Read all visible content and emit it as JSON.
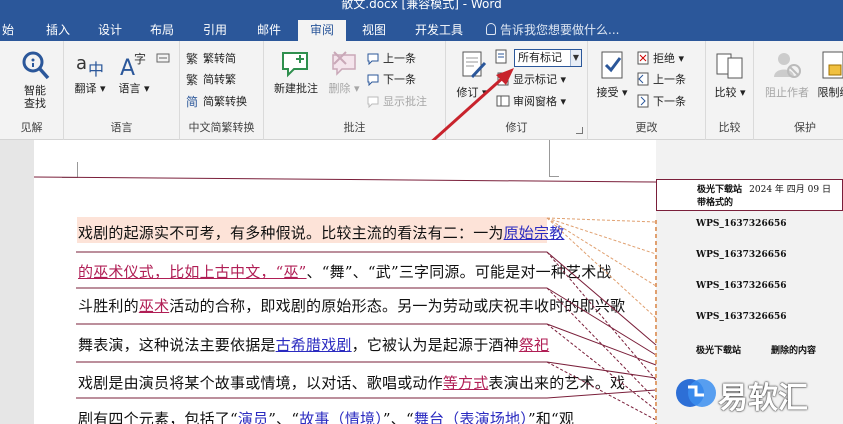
{
  "window": {
    "title": "散文.docx [兼容模式] - Word"
  },
  "tabs": [
    "始",
    "插入",
    "设计",
    "布局",
    "引用",
    "邮件",
    "审阅",
    "视图",
    "开发工具"
  ],
  "active_tab": "审阅",
  "tell_me": "告诉我您想要做什么...",
  "groups": {
    "proofing": {
      "label": "见解",
      "smart_lookup": "智能\n查找"
    },
    "language": {
      "label": "语言",
      "translate": "翻译",
      "language": "语言"
    },
    "chinese_conversion": {
      "label": "中文简繁转换",
      "to_traditional": "繁转简",
      "to_simplified": "简转繁",
      "convert": "简繁转换"
    },
    "comments": {
      "label": "批注",
      "new_comment": "新建批注",
      "delete": "删除",
      "previous": "上一条",
      "next": "下一条",
      "show_comments": "显示批注"
    },
    "tracking": {
      "label": "修订",
      "track_changes": "修订",
      "markup_dropdown": "所有标记",
      "show_markup": "显示标记",
      "reviewing_pane": "审阅窗格"
    },
    "changes": {
      "label": "更改",
      "accept": "接受",
      "reject": "拒绝",
      "previous": "上一条",
      "next": "下一条"
    },
    "compare": {
      "label": "比较",
      "compare": "比较"
    },
    "protect": {
      "label": "保护",
      "block_authors": "阻止作者",
      "restrict_editing": "限制编"
    }
  },
  "document": {
    "lines": [
      {
        "segments": [
          {
            "t": "戏剧的起源实不可考，有多种假说。比较主流的看法有二：一为",
            "s": ""
          },
          {
            "t": "原始宗教",
            "s": "ins"
          }
        ]
      },
      {
        "segments": [
          {
            "t": "的巫术仪式，比如上古中文，“巫”",
            "s": "ins2"
          },
          {
            "t": "、“舞”、“武”三字同源。可能是对一种艺术战",
            "s": ""
          }
        ]
      },
      {
        "segments": [
          {
            "t": "斗胜利的",
            "s": ""
          },
          {
            "t": "巫术",
            "s": "ins2"
          },
          {
            "t": "活动的合称，即戏剧的原始形态。另一为劳动或庆祝丰收时的即兴歌",
            "s": ""
          }
        ]
      },
      {
        "segments": [
          {
            "t": "舞表演，这种说法主要依据是",
            "s": ""
          },
          {
            "t": "古希腊戏剧",
            "s": "ins"
          },
          {
            "t": "，它被认为是起源于酒神",
            "s": ""
          },
          {
            "t": "祭祀",
            "s": "ins2"
          }
        ]
      },
      {
        "segments": [
          {
            "t": "戏剧是由演员将某个故事或情境，以对话、歌唱或动作",
            "s": ""
          },
          {
            "t": "等方式",
            "s": "ins2"
          },
          {
            "t": "表演出来的艺术。戏",
            "s": ""
          }
        ]
      },
      {
        "segments": [
          {
            "t": "剧有四个元素，包括了“",
            "s": ""
          },
          {
            "t": "演员",
            "s": "ins"
          },
          {
            "t": "”、“",
            "s": ""
          },
          {
            "t": "故事（情境）",
            "s": "ins"
          },
          {
            "t": "”、“",
            "s": ""
          },
          {
            "t": "舞台（表演场地）",
            "s": "ins"
          },
          {
            "t": "”和“观",
            "s": ""
          }
        ]
      }
    ]
  },
  "balloons": [
    {
      "author": "极光下载站",
      "date": "2024 年 四月 09 日",
      "text": "带格式的"
    },
    {
      "text": "WPS_1637326656"
    },
    {
      "text": "WPS_1637326656"
    },
    {
      "text": "WPS_1637326656"
    },
    {
      "text": "WPS_1637326656"
    },
    {
      "text": "极光下载站",
      "extra": "删除的内容"
    }
  ],
  "watermark": {
    "brand": "易软汇"
  },
  "colors": {
    "title_bar": "#2b579a",
    "ribbon": "#f3f3f3",
    "insert_blue": "#2b2bc0",
    "insert_red": "#b01e55",
    "highlight": "#fde3d8",
    "arrow": "#c8232c"
  }
}
